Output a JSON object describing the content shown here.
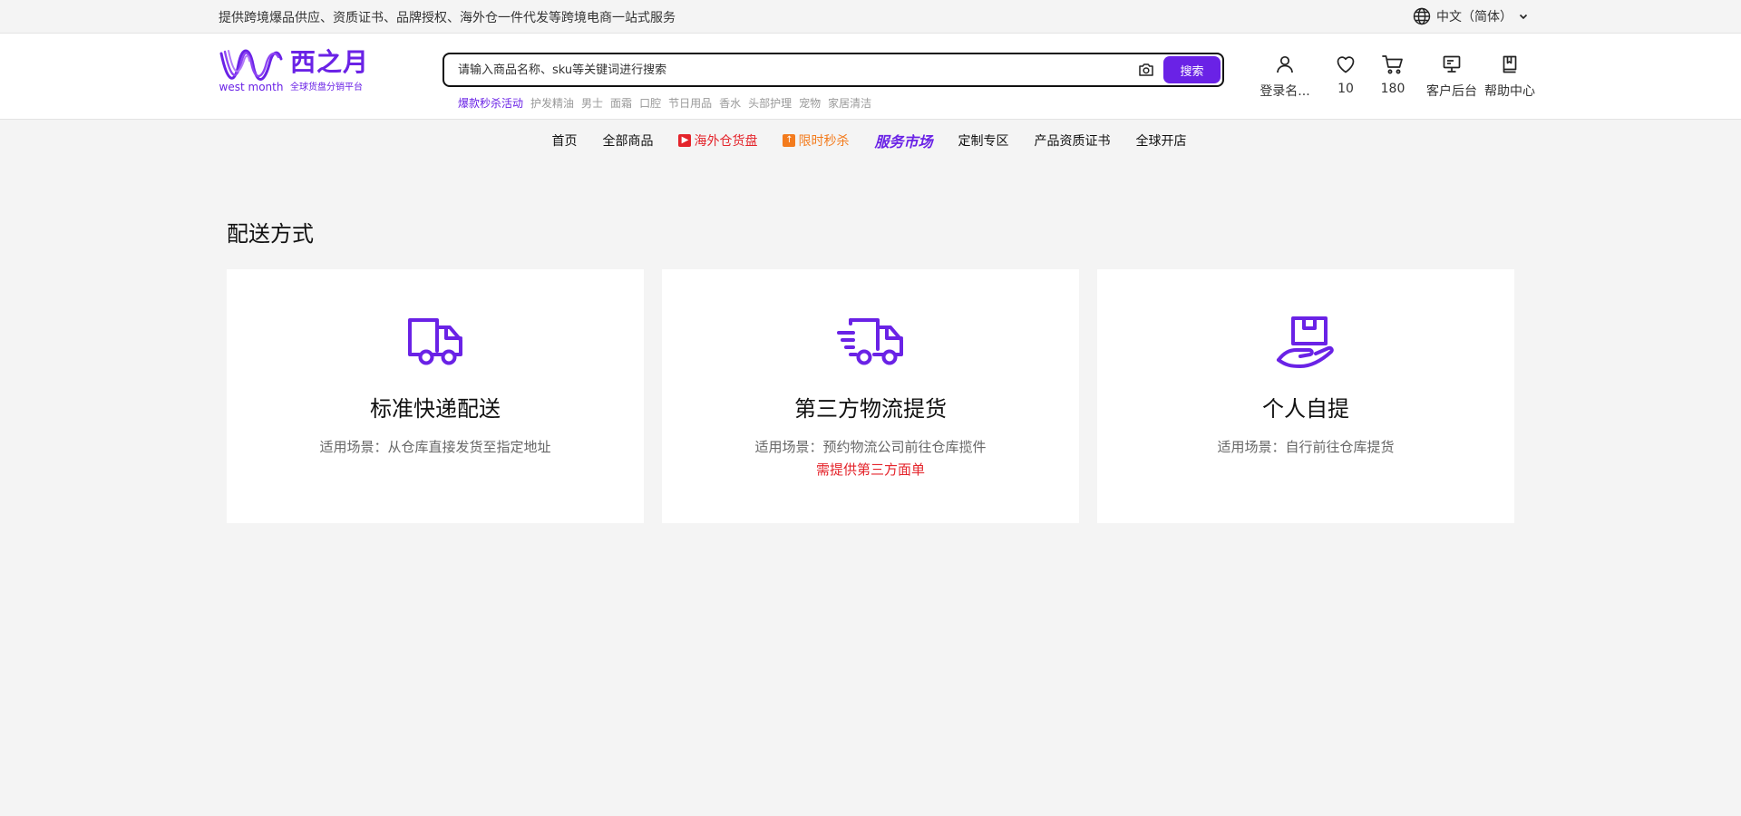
{
  "topbar": {
    "slogan": "提供跨境爆品供应、资质证书、品牌授权、海外仓一件代发等跨境电商一站式服务",
    "language": "中文（简体）"
  },
  "logo": {
    "name_cn": "西之月",
    "name_en": "west month",
    "tagline": "全球货盘分销平台"
  },
  "search": {
    "placeholder": "请输入商品名称、sku等关键词进行搜索",
    "button": "搜索",
    "hot_terms": [
      "爆款秒杀活动",
      "护发精油",
      "男士",
      "面霜",
      "口腔",
      "节日用品",
      "香水",
      "头部护理",
      "宠物",
      "家居清洁"
    ]
  },
  "user_icons": {
    "login": "登录名...",
    "favorites": "10",
    "cart": "180",
    "backend": "客户后台",
    "help": "帮助中心"
  },
  "nav": [
    "首页",
    "全部商品",
    "海外仓货盘",
    "限时秒杀",
    "服务市场",
    "定制专区",
    "产品资质证书",
    "全球开店"
  ],
  "colors": {
    "brand": "#6a22e6",
    "red": "#e4242b",
    "orange": "#f37b1d"
  },
  "page": {
    "title": "配送方式",
    "cards": [
      {
        "icon": "truck-icon",
        "title": "标准快递配送",
        "desc": "适用场景：从仓库直接发货至指定地址",
        "note": ""
      },
      {
        "icon": "fast-truck-icon",
        "title": "第三方物流提货",
        "desc": "适用场景：预约物流公司前往仓库揽件",
        "note": "需提供第三方面单"
      },
      {
        "icon": "hand-box-icon",
        "title": "个人自提",
        "desc": "适用场景：自行前往仓库提货",
        "note": ""
      }
    ]
  }
}
